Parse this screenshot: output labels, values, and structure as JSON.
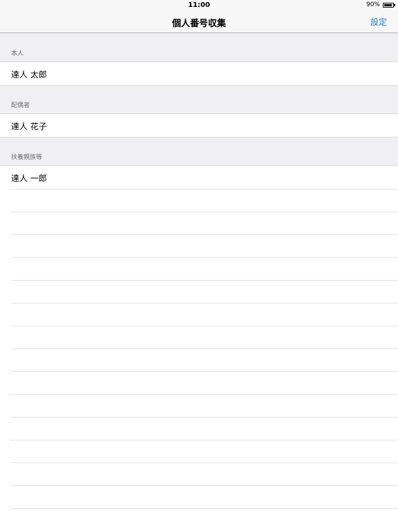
{
  "status_bar": {
    "time": "11:00",
    "battery_percent_label": "90%",
    "battery_level": 0.9
  },
  "nav": {
    "title": "個人番号収集",
    "settings_label": "設定",
    "accent_color": "#1a7fc1"
  },
  "sections": [
    {
      "header": "本人",
      "name": "達人 太郎"
    },
    {
      "header": "配偶者",
      "name": "達人 花子"
    },
    {
      "header": "扶養親族等",
      "name": "達人 一郎"
    }
  ]
}
